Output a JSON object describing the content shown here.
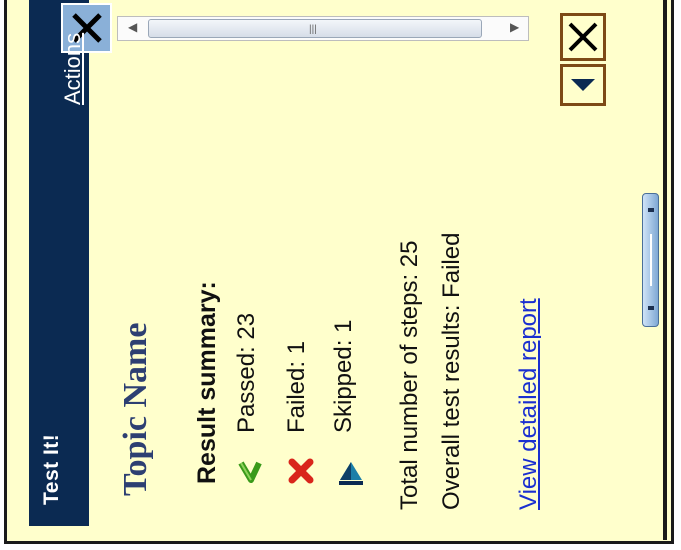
{
  "window": {
    "title": "Test It!",
    "actions_label": "Actions"
  },
  "content": {
    "topic_name": "Topic Name",
    "result_summary_label": "Result summary:",
    "passed": "Passed: 23",
    "failed": "Failed: 1",
    "skipped": "Skipped: 1",
    "total_steps": "Total number of steps: 25",
    "overall_result": "Overall test results: Failed",
    "report_link": "View detailed report"
  },
  "icons": {
    "close": "close-icon",
    "passed": "checkmark-icon",
    "failed": "x-icon",
    "skipped": "skip-icon",
    "menu": "dropdown-arrow-icon"
  },
  "colors": {
    "background": "#ffffcc",
    "titlebar": "#0b2a52",
    "topic": "#2d3f72",
    "link": "#1a2fd0",
    "passed": "#3a9a1a",
    "failed": "#d9261c"
  }
}
